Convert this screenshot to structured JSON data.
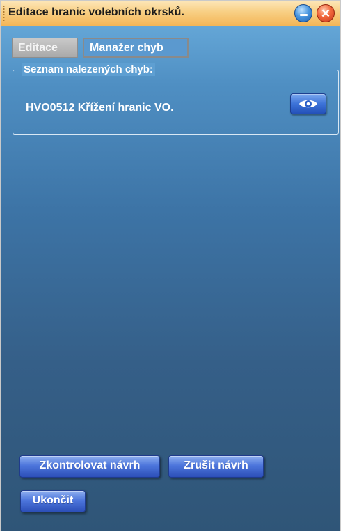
{
  "window": {
    "title": "Editace hranic volebních okrsků."
  },
  "titlebar_buttons": {
    "minimize_icon": "minimize-icon",
    "close_icon": "close-icon",
    "close_glyph": "✕"
  },
  "tabs": [
    {
      "label": "Editace",
      "active": false
    },
    {
      "label": "Manažer chyb",
      "active": true
    }
  ],
  "error_list": {
    "legend": "Seznam nalezených chyb:",
    "items": [
      {
        "text": "HVO0512 Křížení hranic VO.",
        "action_icon": "eye-icon"
      }
    ]
  },
  "buttons": {
    "check_design": "Zkontrolovat návrh",
    "cancel_design": "Zrušit návrh",
    "exit": "Ukončit"
  },
  "colors": {
    "titlebar": "#f8cf83",
    "panel_top": "#6db0df",
    "panel_bottom": "#2f5577",
    "button_blue": "#4d76dc"
  }
}
